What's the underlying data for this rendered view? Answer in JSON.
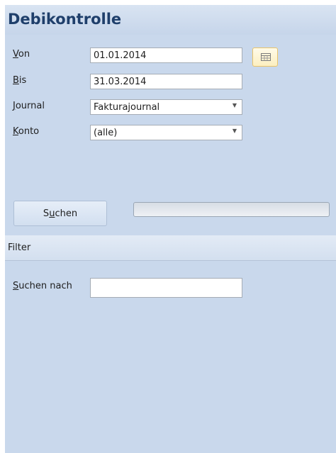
{
  "header": {
    "title": "Debikontrolle"
  },
  "form": {
    "von": {
      "label_u": "V",
      "label_rest": "on",
      "value": "01.01.2014"
    },
    "bis": {
      "label_u": "B",
      "label_rest": "is",
      "value": "31.03.2014"
    },
    "journal": {
      "label_u": "J",
      "label_rest": "ournal",
      "value": "Fakturajournal"
    },
    "konto": {
      "label_u": "K",
      "label_rest": "onto",
      "value": "(alle)"
    }
  },
  "calendar_button": {
    "icon": "calendar-icon"
  },
  "search_button": {
    "label_pre": "S",
    "label_u": "u",
    "label_rest": "chen"
  },
  "progress": {
    "value": 0
  },
  "filter": {
    "title": "Filter",
    "suchen_nach": {
      "label_u": "S",
      "label_rest": "uchen nach",
      "value": ""
    }
  },
  "colors": {
    "title": "#1f3f6b",
    "panel_bg": "#c9d8ec",
    "focus_border": "#e8c36a"
  }
}
